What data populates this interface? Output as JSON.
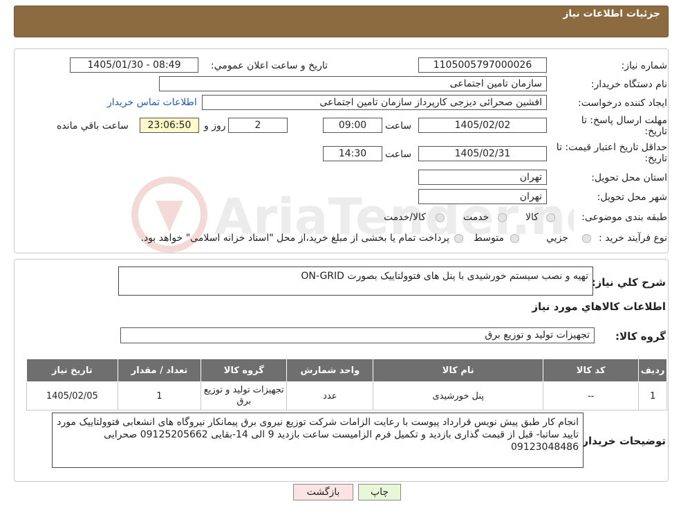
{
  "header": {
    "title": "جزئیات اطلاعات نیاز"
  },
  "form": {
    "need_number_label": "شماره نیاز:",
    "need_number": "1105005797000026",
    "announce_label": "تاریخ و ساعت اعلان عمومي:",
    "announce_value": "1405/01/30 - 08:49",
    "buyer_org_label": "نام دستگاه خریدار:",
    "buyer_org": "سازمان تامین اجتماعی",
    "creator_label": "ایجاد کننده درخواست:",
    "creator": "افشین صحرائی دیزجی کارپرداز سازمان تامین اجتماعی",
    "contact_link": "اطلاعات تماس خریدار",
    "deadline_label": "مهلت ارسال پاسخ: تا تاریخ:",
    "deadline_date": "1405/02/02",
    "time_label": "ساعت",
    "deadline_time": "09:00",
    "days_value": "2",
    "days_label": "روز و",
    "remaining_time": "23:06:50",
    "remaining_label": "ساعت باقي مانده",
    "validity_label": "حداقل تاریخ اعتبار قیمت: تا تاریخ:",
    "validity_date": "1405/02/31",
    "validity_time": "14:30",
    "province_label": "استان محل تحویل:",
    "province": "تهران",
    "city_label": "شهر محل تحویل:",
    "city": "تهران",
    "category_label": "طبقه بندی موضوعی:",
    "category_options": [
      "کالا",
      "خدمت",
      "کالا/خدمت"
    ],
    "process_label": "نوع فرآیند خرید :",
    "process_options": [
      "جزيي",
      "متوسط"
    ],
    "process_note": "پرداخت تمام یا بخشی از مبلغ خرید،از محل \"اسناد خزانه اسلامی\" خواهد بود."
  },
  "summary": {
    "label": "شرح كلي نياز:",
    "text": "تهیه و نصب سیستم خورشیدی با پنل های فتوولتاییک بصورت ON-GRID"
  },
  "goods": {
    "section_title": "اطلاعات کالاهاي مورد نياز",
    "group_label": "گروه کالا:",
    "group_value": "تجهیزات تولید و توزیع برق",
    "columns": [
      "رديف",
      "کد کالا",
      "نام کالا",
      "واحد شمارش",
      "گروه کالا",
      "تعداد / مقدار",
      "تاریخ نیاز"
    ],
    "rows": [
      [
        "1",
        "--",
        "پنل خورشیدی",
        "عدد",
        "تجهیزات تولید و توزیع برق",
        "1",
        "1405/02/05"
      ]
    ]
  },
  "buyer_notes": {
    "label": "توضیحات خریدار:",
    "text": "انجام کار طبق پیش نویس قرارداد پیوست با رعایت الزامات شرکت توزیع نیروی برق پیمانکار نیروگاه های انشعابی فتوولتاییک مورد تایید ساتبا- قبل از قیمت گذاری بازدید و تکمیل فرم الزامیست ساعت بازدید 9 الی 14-بقایی 09125205662 صحرایی 09123048486"
  },
  "buttons": {
    "print": "چاپ",
    "back": "بازگشت"
  },
  "watermark": {
    "text": "AriaTender.neT"
  },
  "colors": {
    "header": "#8B6B3F",
    "table_header": "#6f6f6f",
    "link": "#1a5db5",
    "back_button": "#fde4e4",
    "print_button": "#e8f7d8"
  }
}
